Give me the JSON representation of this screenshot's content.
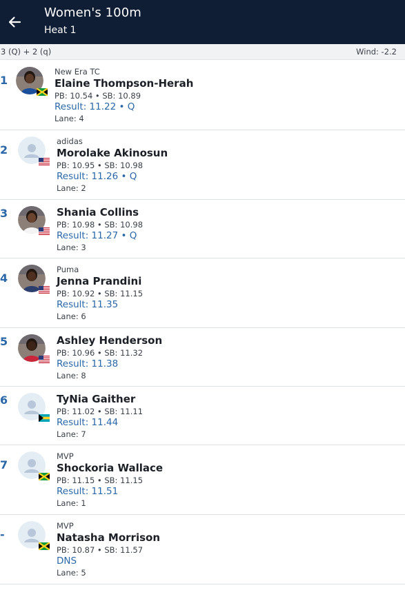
{
  "header": {
    "title": "Women's 100m",
    "subtitle": "Heat 1",
    "back_icon": "arrow-left-icon"
  },
  "infobar": {
    "qualifier": "3 (Q) + 2 (q)",
    "wind": "Wind: -2.2"
  },
  "colors": {
    "header_bg": "#0f1e35",
    "accent": "#2a67a8",
    "divider": "#dde0e4"
  },
  "athletes": [
    {
      "rank": "1",
      "team": "New Era TC",
      "name": "Elaine Thompson-Herah",
      "pbsb": "PB: 10.54 • SB: 10.89",
      "result": "Result: 11.22 • Q",
      "lane": "Lane: 4",
      "flag": "JAM",
      "avatar": "photo"
    },
    {
      "rank": "2",
      "team": "adidas",
      "name": "Morolake Akinosun",
      "pbsb": "PB: 10.95 • SB: 10.98",
      "result": "Result: 11.26 • Q",
      "lane": "Lane: 2",
      "flag": "USA",
      "avatar": "placeholder"
    },
    {
      "rank": "3",
      "team": "",
      "name": "Shania Collins",
      "pbsb": "PB: 10.98 • SB: 10.98",
      "result": "Result: 11.27 • Q",
      "lane": "Lane: 3",
      "flag": "USA",
      "avatar": "photo"
    },
    {
      "rank": "4",
      "team": "Puma",
      "name": "Jenna Prandini",
      "pbsb": "PB: 10.92 • SB: 11.15",
      "result": "Result: 11.35",
      "lane": "Lane: 6",
      "flag": "USA",
      "avatar": "photo"
    },
    {
      "rank": "5",
      "team": "",
      "name": "Ashley Henderson",
      "pbsb": "PB: 10.96 • SB: 11.32",
      "result": "Result: 11.38",
      "lane": "Lane: 8",
      "flag": "USA",
      "avatar": "photo"
    },
    {
      "rank": "6",
      "team": "",
      "name": "TyNia Gaither",
      "pbsb": "PB: 11.02 • SB: 11.11",
      "result": "Result: 11.44",
      "lane": "Lane: 7",
      "flag": "BAH",
      "avatar": "placeholder"
    },
    {
      "rank": "7",
      "team": "MVP",
      "name": "Shockoria Wallace",
      "pbsb": "PB: 11.15 • SB: 11.15",
      "result": "Result: 11.51",
      "lane": "Lane: 1",
      "flag": "JAM",
      "avatar": "placeholder"
    },
    {
      "rank": "-",
      "team": "MVP",
      "name": "Natasha Morrison",
      "pbsb": "PB: 10.87 • SB: 11.57",
      "result": "DNS",
      "lane": "Lane: 5",
      "flag": "JAM",
      "avatar": "placeholder"
    }
  ]
}
